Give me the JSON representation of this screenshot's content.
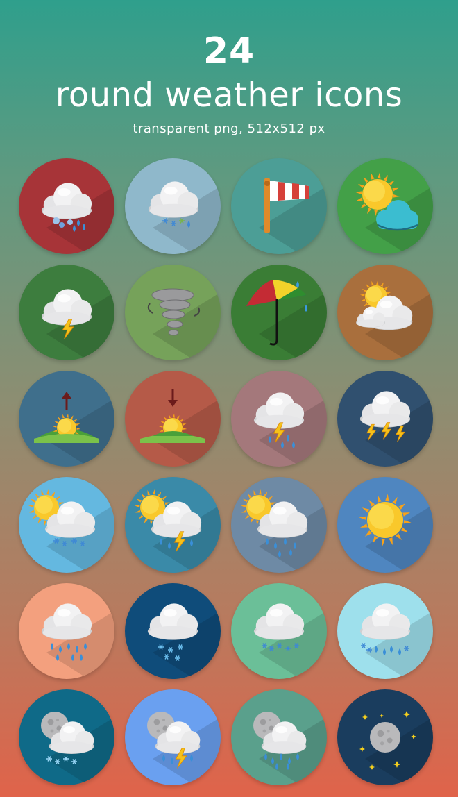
{
  "header": {
    "count": "24",
    "title": "round weather icons",
    "subtitle": "transparent png, 512x512 px"
  },
  "icons": [
    {
      "name": "cloud-rain-hail-icon",
      "bg": "#a73438",
      "kind": "cloud-hail"
    },
    {
      "name": "cloud-snow-rain-icon",
      "bg": "#8fb8cb",
      "kind": "cloud-snowrain"
    },
    {
      "name": "windsock-icon",
      "bg": "#4c9e96",
      "kind": "windsock"
    },
    {
      "name": "sun-cloud-icon",
      "bg": "#43a048",
      "kind": "sun-cloud-cyan"
    },
    {
      "name": "cloud-lightning-icon",
      "bg": "#3d7d3e",
      "kind": "cloud-lightning"
    },
    {
      "name": "tornado-icon",
      "bg": "#76a25a",
      "kind": "tornado"
    },
    {
      "name": "umbrella-rain-icon",
      "bg": "#3a7d35",
      "kind": "umbrella"
    },
    {
      "name": "sun-behind-clouds-icon",
      "bg": "#a96f3d",
      "kind": "sun-clouds"
    },
    {
      "name": "sunrise-icon",
      "bg": "#3f6f8c",
      "kind": "sunrise"
    },
    {
      "name": "sunset-icon",
      "bg": "#b55a48",
      "kind": "sunset"
    },
    {
      "name": "cloud-thunder-rain-icon",
      "bg": "#a4787b",
      "kind": "cloud-thunder-rain"
    },
    {
      "name": "cloud-multi-lightning-icon",
      "bg": "#30506f",
      "kind": "cloud-multi-lightning"
    },
    {
      "name": "sun-cloud-snow-icon",
      "bg": "#64b8e0",
      "kind": "sun-cloud-snow"
    },
    {
      "name": "sun-cloud-thunder-icon",
      "bg": "#3a8aa8",
      "kind": "sun-cloud-thunder"
    },
    {
      "name": "sun-cloud-rain-icon",
      "bg": "#6e8aa5",
      "kind": "sun-cloud-rain"
    },
    {
      "name": "sun-icon",
      "bg": "#4f86c0",
      "kind": "sun"
    },
    {
      "name": "cloud-heavy-rain-icon",
      "bg": "#f3a07e",
      "kind": "cloud-rain"
    },
    {
      "name": "cloud-snow-icon",
      "bg": "#0f4c7a",
      "kind": "cloud-snow"
    },
    {
      "name": "cloud-light-snow-icon",
      "bg": "#6bbf98",
      "kind": "cloud-snow-light"
    },
    {
      "name": "cloud-rain-snow-icon",
      "bg": "#9ee0ec",
      "kind": "cloud-rain-snow"
    },
    {
      "name": "moon-cloud-snow-icon",
      "bg": "#0f6a88",
      "kind": "moon-cloud-snow"
    },
    {
      "name": "moon-cloud-thunder-icon",
      "bg": "#6aa0f0",
      "kind": "moon-cloud-thunder"
    },
    {
      "name": "moon-cloud-rain-icon",
      "bg": "#5aa08c",
      "kind": "moon-cloud-rain"
    },
    {
      "name": "moon-stars-icon",
      "bg": "#1a3d5e",
      "kind": "moon-stars"
    }
  ]
}
